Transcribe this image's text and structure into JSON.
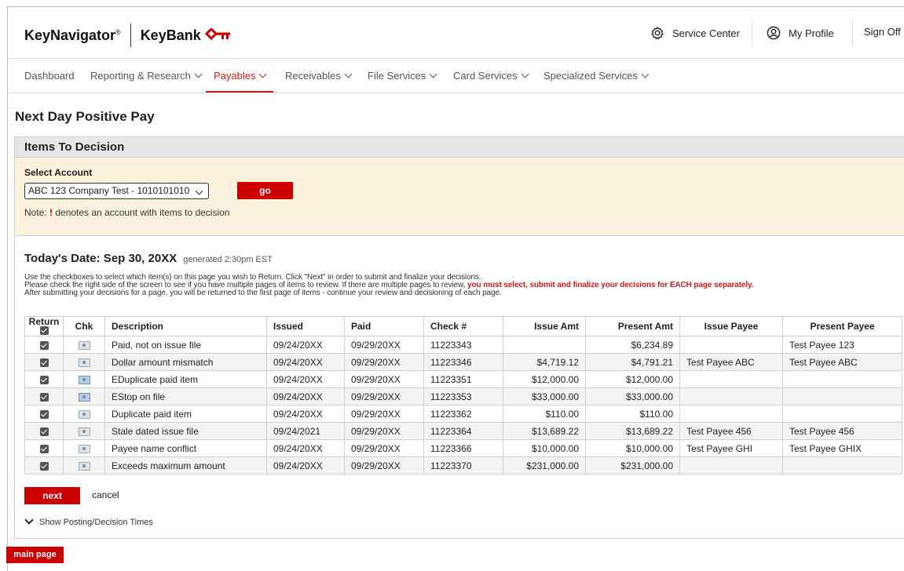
{
  "header": {
    "brand_primary": "KeyNavigator",
    "brand_reg": "®",
    "brand_secondary": "KeyBank",
    "service_center": "Service Center",
    "my_profile": "My Profile",
    "sign_off": "Sign Off"
  },
  "nav": {
    "items": [
      {
        "label": "Dashboard"
      },
      {
        "label": "Reporting & Research"
      },
      {
        "label": "Payables"
      },
      {
        "label": "Receivables"
      },
      {
        "label": "File Services"
      },
      {
        "label": "Card Services"
      },
      {
        "label": "Specialized Services"
      }
    ],
    "active_index": 2
  },
  "page": {
    "title": "Next Day Positive Pay",
    "section_title": "Items To Decision"
  },
  "account": {
    "label": "Select Account",
    "selected": "ABC 123 Company Test - 1010101010",
    "go_label": "go",
    "note_prefix": "Note: ",
    "note_bang": "!",
    "note_suffix": " denotes an account with items to decision"
  },
  "items": {
    "date_heading": "Today's Date: Sep 30, 20XX",
    "generated": "generated 2:30pm EST",
    "instr_line1": "Use the checkboxes to select which item(s) on this page you wish to Return. Click \"Next\" in order to submit and finalize your decisions.",
    "instr_line2_a": "Please check the right side of the screen to see if you have multiple pages of items to review. If there are multiple pages to review, ",
    "instr_line2_b": "you must select, submit and finalize your decisions for EACH page separately.",
    "instr_line3": "After submitting your decisions for a page, you will be returned to the first page of items - continue your review and decisioning of each page.",
    "columns": {
      "return": "Return",
      "chk": "Chk",
      "description": "Description",
      "issued": "Issued",
      "paid": "Paid",
      "check": "Check #",
      "issue_amt": "Issue Amt",
      "present_amt": "Present Amt",
      "issue_payee": "Issue Payee",
      "present_payee": "Present Payee"
    },
    "rows": [
      {
        "description": "Paid, not on issue file",
        "issued": "09/24/20XX",
        "paid": "09/29/20XX",
        "check": "11223343",
        "issue_amt": "",
        "present_amt": "$6,234.89",
        "issue_payee": "",
        "present_payee": "Test Payee 123"
      },
      {
        "description": "Dollar amount mismatch",
        "issued": "09/24/20XX",
        "paid": "09/29/20XX",
        "check": "11223346",
        "issue_amt": "$4,719.12",
        "present_amt": "$4,791.21",
        "issue_payee": "Test Payee ABC",
        "present_payee": "Test Payee ABC"
      },
      {
        "description": "EDuplicate paid item",
        "issued": "09/24/20XX",
        "paid": "09/29/20XX",
        "check": "11223351",
        "issue_amt": "$12,000.00",
        "present_amt": "$12,000.00",
        "issue_payee": "",
        "present_payee": ""
      },
      {
        "description": "EStop on file",
        "issued": "09/24/20XX",
        "paid": "09/29/20XX",
        "check": "11223353",
        "issue_amt": "$33,000.00",
        "present_amt": "$33,000.00",
        "issue_payee": "",
        "present_payee": ""
      },
      {
        "description": "Duplicate paid item",
        "issued": "09/24/20XX",
        "paid": "09/29/20XX",
        "check": "11223362",
        "issue_amt": "$110.00",
        "present_amt": "$110.00",
        "issue_payee": "",
        "present_payee": ""
      },
      {
        "description": "Stale dated issue file",
        "issued": "09/24/2021",
        "paid": "09/29/20XX",
        "check": "11223364",
        "issue_amt": "$13,689.22",
        "present_amt": "$13,689.22",
        "issue_payee": "Test Payee 456",
        "present_payee": "Test Payee 456"
      },
      {
        "description": "Payee name conflict",
        "issued": "09/24/20XX",
        "paid": "09/29/20XX",
        "check": "11223366",
        "issue_amt": "$10,000.00",
        "present_amt": "$10,000.00",
        "issue_payee": "Test Payee GHI",
        "present_payee": "Test Payee GHIX"
      },
      {
        "description": "Exceeds maximum amount",
        "issued": "09/24/20XX",
        "paid": "09/29/20XX",
        "check": "11223370",
        "issue_amt": "$231,000.00",
        "present_amt": "$231,000.00",
        "issue_payee": "",
        "present_payee": ""
      }
    ],
    "next_label": "next",
    "cancel_label": "cancel",
    "show_times_label": "Show Posting/Decision Times"
  },
  "footer": {
    "main_page_label": "main page"
  },
  "colors": {
    "accent_red": "#cc0000",
    "panel_beige": "#fbf2dd"
  },
  "icons": {
    "service_center": "gear-icon",
    "my_profile": "user-circle-icon",
    "brand": "key-icon",
    "check_image": "check-image-icon"
  }
}
